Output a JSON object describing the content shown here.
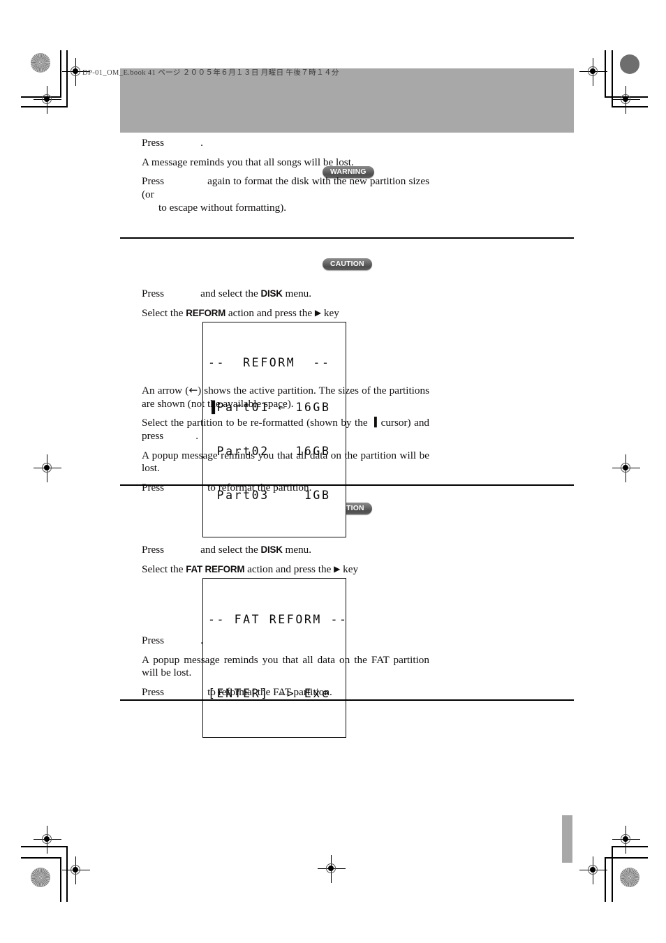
{
  "page": {
    "header_meta": "DP-01_OM_E.book  41 ページ  ２００５年６月１３日  月曜日  午後７時１４分",
    "page_number": "41"
  },
  "badges": {
    "warning": "WARNING",
    "caution_reform": "CAUTION",
    "caution_fat_reform": "CAUTION"
  },
  "section_format": {
    "steps": [
      {
        "id": "press-enter",
        "pre": "Press",
        "post": "."
      },
      {
        "id": "songs-lost-note",
        "text": "A message reminds you that all songs will be lost."
      },
      {
        "id": "press-again",
        "pre": "Press",
        "post": "again to format the disk with the new partition sizes (or",
        "line2": "to escape without formatting)."
      }
    ]
  },
  "section_reform": {
    "steps": [
      {
        "id": "press-menu-disk",
        "pre": "Press",
        "post": "and select the",
        "mono": "DISK",
        "tail": "menu."
      },
      {
        "id": "select-reform-action",
        "pre": "Select the",
        "mono": "REFORM",
        "mid": "action and press the",
        "key_icon": "▶",
        "tail": "key"
      }
    ],
    "lcd": {
      "name": "reform-display",
      "lines": [
        "--  REFORM  --",
        "▐Part01 ← 16GB",
        " Part02   16GB",
        " Part03    1GB"
      ],
      "header": "--  REFORM  --",
      "rows": [
        {
          "cursor": true,
          "name": "Part01",
          "active": true,
          "size": "16GB"
        },
        {
          "cursor": false,
          "name": "Part02",
          "active": false,
          "size": "16GB"
        },
        {
          "cursor": false,
          "name": "Part03",
          "active": false,
          "size": "1GB"
        }
      ]
    },
    "notes": [
      {
        "id": "arrow-explanation",
        "a": "An arrow (",
        "arrow": "←",
        "b": ") shows the active partition. The sizes of the partitions are shown (not the available space)."
      },
      {
        "id": "select-partition",
        "a": "Select the partition to be re-formatted (shown by the",
        "cursor_icon": "▐",
        "b": "cursor) and press",
        "c": "."
      },
      {
        "id": "popup-data-lost",
        "text": "A popup message reminds you that all data on the partition will be lost."
      },
      {
        "id": "press-reformat",
        "pre": "Press",
        "post": "to reformat the partition."
      }
    ]
  },
  "section_fat_reform": {
    "steps": [
      {
        "id": "press-menu-disk",
        "pre": "Press",
        "post": "and select the",
        "mono": "DISK",
        "tail": "menu."
      },
      {
        "id": "select-fat-reform-action",
        "pre": "Select the",
        "mono": "FAT REFORM",
        "mid": "action and press the",
        "key_icon": "▶",
        "tail": "key"
      }
    ],
    "lcd": {
      "name": "fat-reform-display",
      "header": "--  FAT REFORM  --",
      "body": "[ENTER] -> Exe",
      "lines": [
        "-- FAT REFORM --",
        "",
        "[ENTER] -> Exe"
      ]
    },
    "notes": [
      {
        "id": "press-enter",
        "pre": "Press",
        "post": "."
      },
      {
        "id": "popup-fat-data-lost",
        "text": "A popup message reminds you that all data on the FAT partition will be lost."
      },
      {
        "id": "press-reformat-fat",
        "pre": "Press",
        "post": "to reformat the FAT partition."
      }
    ]
  },
  "colors": {
    "header_band": "#a8a8a8",
    "badge_dark": "#4e4e4e",
    "text": "#100d0d",
    "tab_marker": "#a8a8a8"
  }
}
